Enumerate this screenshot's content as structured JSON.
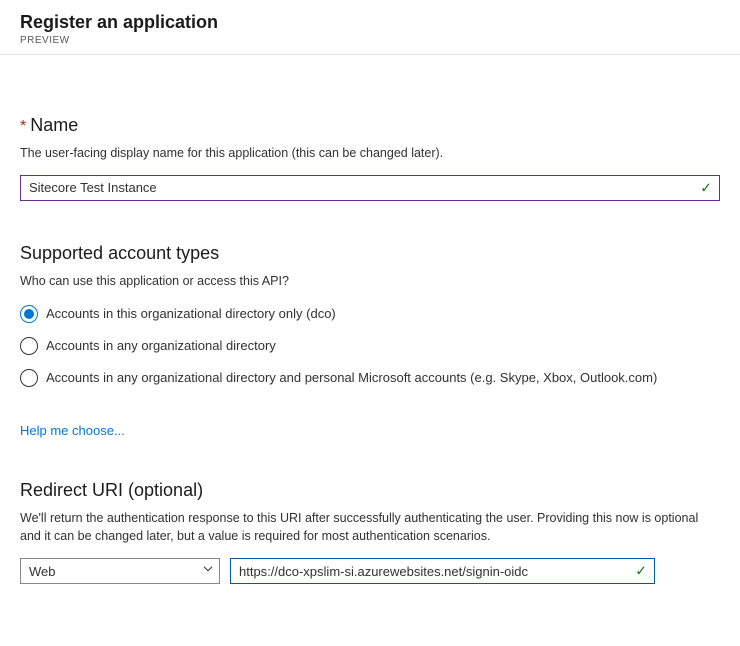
{
  "header": {
    "title": "Register an application",
    "badge": "PREVIEW"
  },
  "name_section": {
    "asterisk": "*",
    "title": "Name",
    "desc": "The user-facing display name for this application (this can be changed later).",
    "value": "Sitecore Test Instance"
  },
  "accounts_section": {
    "title": "Supported account types",
    "desc": "Who can use this application or access this API?",
    "options": [
      {
        "label": "Accounts in this organizational directory only (dco)",
        "selected": true
      },
      {
        "label": "Accounts in any organizational directory",
        "selected": false
      },
      {
        "label": "Accounts in any organizational directory and personal Microsoft accounts (e.g. Skype, Xbox, Outlook.com)",
        "selected": false
      }
    ],
    "help_link": "Help me choose..."
  },
  "redirect_section": {
    "title": "Redirect URI (optional)",
    "desc": "We'll return the authentication response to this URI after successfully authenticating the user. Providing this now is optional and it can be changed later, but a value is required for most authentication scenarios.",
    "type_value": "Web",
    "uri_value": "https://dco-xpslim-si.azurewebsites.net/signin-oidc"
  }
}
